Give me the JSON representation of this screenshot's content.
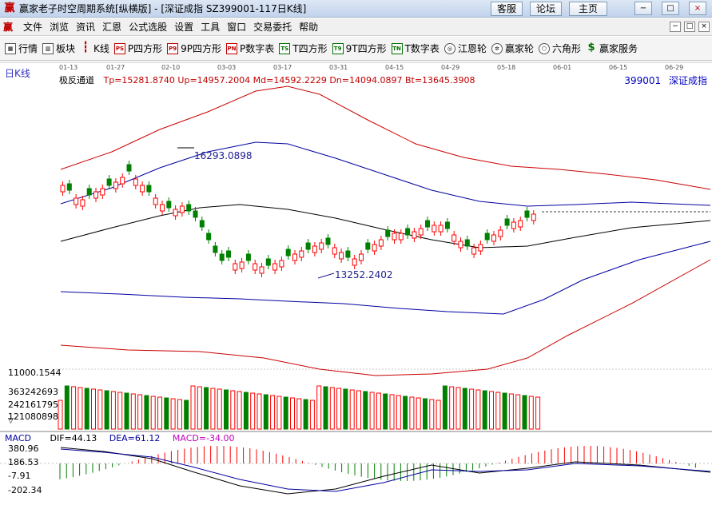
{
  "window": {
    "title": "赢家老子时空周期系统[纵横版] - [深证成指  SZ399001-117日K线]",
    "buttons": [
      "客服",
      "论坛",
      "主页"
    ],
    "controls": [
      "−",
      "□",
      "×"
    ]
  },
  "menu": {
    "items": [
      "文件",
      "浏览",
      "资讯",
      "汇恩",
      "公式选股",
      "设置",
      "工具",
      "窗口",
      "交易委托",
      "帮助"
    ],
    "mdi_controls": [
      "−",
      "□",
      "×"
    ]
  },
  "toolbar": {
    "items": [
      {
        "label": "行情",
        "icon": "grid-icon"
      },
      {
        "label": "板块",
        "icon": "blocks-icon"
      },
      {
        "label": "K线",
        "icon": "candle-icon"
      },
      {
        "label": "P四方形",
        "icon": "ps-icon",
        "code": "PS"
      },
      {
        "label": "9P四方形",
        "icon": "p9-icon",
        "code": "P9"
      },
      {
        "label": "P数字表",
        "icon": "pn-icon",
        "code": "PN"
      },
      {
        "label": "T四方形",
        "icon": "ts-icon",
        "code": "TS"
      },
      {
        "label": "9T四方形",
        "icon": "t9-icon",
        "code": "T9"
      },
      {
        "label": "T数字表",
        "icon": "tn-icon",
        "code": "TN"
      },
      {
        "label": "江恩轮",
        "icon": "gann-wheel-icon"
      },
      {
        "label": "赢家轮",
        "icon": "winner-wheel-icon"
      },
      {
        "label": "六角形",
        "icon": "hexagon-icon"
      },
      {
        "label": "赢家服务",
        "icon": "dollar-icon"
      }
    ]
  },
  "chart": {
    "period": "日K线",
    "indicator": "极反通道",
    "tp": "Tp=15281.8740",
    "up": "Up=14957.2004",
    "md": "Md=14592.2229",
    "dn": "Dn=14094.0897",
    "bt": "Bt=13645.3908",
    "stock_code": "399001",
    "stock_name": "深证成指",
    "date_ticks": [
      "01-13",
      "01-27",
      "02-10",
      "03-03",
      "03-17",
      "03-31",
      "04-15",
      "04-29",
      "05-18",
      "06-01",
      "06-15",
      "06-29"
    ],
    "high_annotation": "16293.0898",
    "low_annotation": "13252.2402",
    "volume_axis": [
      "11000.1544",
      "363242693",
      "242161795",
      "121080898"
    ],
    "macd_axis": [
      "380.96",
      "186.53",
      "-7.91",
      "-202.34"
    ],
    "macd": {
      "name": "MACD",
      "dif": "DIF=44.13",
      "dea": "DEA=61.12",
      "macd": "MACD=-34.00"
    },
    "colors": {
      "up": "#ff0000",
      "down": "#008000",
      "upper_band": "#cc0000",
      "mid_band": "#0000a0",
      "center": "#000000",
      "macd": "#c000c0"
    }
  }
}
